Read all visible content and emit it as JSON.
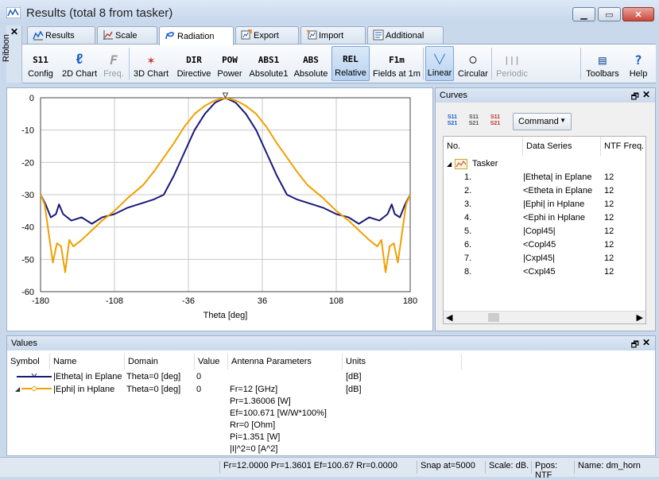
{
  "window": {
    "title": "Results (total 8 from tasker)"
  },
  "ribbon": {
    "label": "Ribbon",
    "close": "✕"
  },
  "tabs": [
    {
      "label": "Results",
      "icon": "results-icon"
    },
    {
      "label": "Scale",
      "icon": "scale-icon"
    },
    {
      "label": "Radiation",
      "icon": "radiation-icon"
    },
    {
      "label": "Export",
      "icon": "export-icon"
    },
    {
      "label": "Import",
      "icon": "import-icon"
    },
    {
      "label": "Additional",
      "icon": "additional-icon"
    }
  ],
  "toolbar": [
    {
      "label": "Config",
      "glyph": "S11"
    },
    {
      "label": "2D Chart",
      "glyph": "ℓ"
    },
    {
      "label": "Freq.",
      "glyph": "F"
    },
    {
      "label": "3D Chart",
      "glyph": "✶"
    },
    {
      "label": "Directive",
      "glyph": "DIR"
    },
    {
      "label": "Power",
      "glyph": "POW"
    },
    {
      "label": "Absolute1",
      "glyph": "ABS1"
    },
    {
      "label": "Absolute",
      "glyph": "ABS"
    },
    {
      "label": "Relative",
      "glyph": "REL"
    },
    {
      "label": "Fields at 1m",
      "glyph": "F1m"
    },
    {
      "label": "Linear",
      "glyph": "╲╱"
    },
    {
      "label": "Circular",
      "glyph": "◯"
    },
    {
      "label": "Periodic",
      "glyph": "|||"
    },
    {
      "label": "Toolbars",
      "glyph": "▤"
    },
    {
      "label": "Help",
      "glyph": "?"
    }
  ],
  "chart_data": {
    "type": "line",
    "xlabel": "Theta [deg]",
    "ylabel": "",
    "xlim": [
      -180,
      180
    ],
    "ylim": [
      -60,
      0
    ],
    "xticks": [
      "-180",
      "-108",
      "-36",
      "36",
      "108",
      "180"
    ],
    "yticks": [
      "0",
      "-10",
      "-20",
      "-30",
      "-40",
      "-50",
      "-60"
    ],
    "grid": true,
    "series": [
      {
        "name": "|Etheta| in Eplane",
        "color": "#1a1a7a",
        "x": [
          -180,
          -175,
          -170,
          -165,
          -162,
          -158,
          -150,
          -140,
          -130,
          -120,
          -108,
          -95,
          -80,
          -70,
          -60,
          -50,
          -40,
          -30,
          -20,
          -10,
          0,
          10,
          20,
          30,
          40,
          50,
          60,
          70,
          80,
          95,
          108,
          120,
          130,
          140,
          150,
          158,
          162,
          165,
          170,
          175,
          180
        ],
        "y": [
          -30,
          -33,
          -37,
          -36,
          -33,
          -36,
          -38,
          -37,
          -39,
          -37,
          -36,
          -34,
          -32.5,
          -31.5,
          -30,
          -24,
          -17,
          -10,
          -5,
          -1.5,
          0,
          -1.5,
          -5,
          -10,
          -17,
          -24,
          -30,
          -31.5,
          -32.5,
          -34,
          -36,
          -37,
          -39,
          -37,
          -38,
          -36,
          -33,
          -36,
          -37,
          -33,
          -30
        ]
      },
      {
        "name": "|Ephi| in Hplane",
        "color": "#f0a000",
        "x": [
          -180,
          -176,
          -172,
          -168,
          -164,
          -160,
          -156,
          -152,
          -148,
          -140,
          -130,
          -120,
          -108,
          -95,
          -80,
          -70,
          -60,
          -50,
          -40,
          -30,
          -20,
          -10,
          0,
          10,
          20,
          30,
          40,
          50,
          60,
          70,
          80,
          95,
          108,
          120,
          130,
          140,
          148,
          152,
          156,
          160,
          164,
          168,
          172,
          176,
          180
        ],
        "y": [
          -30,
          -33,
          -42,
          -51,
          -45,
          -46,
          -54,
          -44,
          -46,
          -44,
          -41,
          -38,
          -35,
          -31,
          -27,
          -23,
          -18.5,
          -14,
          -9,
          -5,
          -2.5,
          -0.8,
          0,
          -0.8,
          -2.5,
          -5,
          -9,
          -14,
          -18.5,
          -23,
          -27,
          -31,
          -35,
          -38,
          -41,
          -44,
          -46,
          -44,
          -54,
          -46,
          -45,
          -51,
          -42,
          -33,
          -30
        ]
      }
    ]
  },
  "curves": {
    "title": "Curves",
    "pin": "🗗",
    "close": "✕",
    "command": "Command",
    "headers": [
      "No.",
      "Data Series",
      "NTF Freq."
    ],
    "group": "Tasker",
    "rows": [
      {
        "no": "1.",
        "series": "|Etheta| in Eplane",
        "freq": "12"
      },
      {
        "no": "2.",
        "series": "<Etheta in Eplane",
        "freq": "12"
      },
      {
        "no": "3.",
        "series": "|Ephi| in Hplane",
        "freq": "12"
      },
      {
        "no": "4.",
        "series": "<Ephi in Hplane",
        "freq": "12"
      },
      {
        "no": "5.",
        "series": "|Copl45|",
        "freq": "12"
      },
      {
        "no": "6.",
        "series": "<Copl45",
        "freq": "12"
      },
      {
        "no": "7.",
        "series": "|Cxpl45|",
        "freq": "12"
      },
      {
        "no": "8.",
        "series": "<Cxpl45",
        "freq": "12"
      }
    ]
  },
  "values": {
    "title": "Values",
    "headers": [
      "Symbol",
      "Name",
      "Domain",
      "Value",
      "Antenna Parameters",
      "Units"
    ],
    "rows": [
      {
        "name": "|Etheta| in Eplane",
        "domain": "Theta=0 [deg]",
        "value": "0",
        "units": "[dB]"
      },
      {
        "name": "|Ephi| in Hplane",
        "domain": "Theta=0 [deg]",
        "value": "0",
        "units": "[dB]"
      }
    ],
    "params": [
      "Fr=12 [GHz]",
      "Pr=1.36006 [W]",
      "Ef=100.671 [W/W*100%]",
      "Rr=0 [Ohm]",
      "Pi=1.351 [W]",
      "|I|^2=0 [A^2]"
    ]
  },
  "status": {
    "summary": "Fr=12.0000 Pr=1.3601 Ef=100.67 Rr=0.0000",
    "snap": "Snap at=5000",
    "scale": "Scale: dB.",
    "ppos": "Ppos: NTF",
    "name": "Name: dm_horn"
  }
}
